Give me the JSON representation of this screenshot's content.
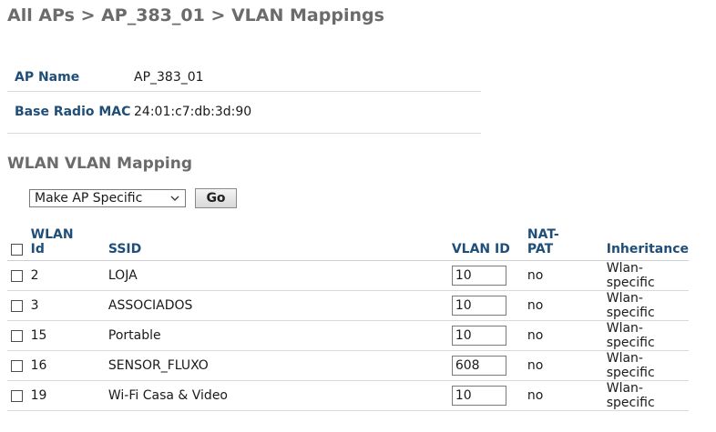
{
  "breadcrumb": "All APs > AP_383_01 > VLAN Mappings",
  "ap_info": {
    "ap_name_label": "AP Name",
    "ap_name_value": "AP_383_01",
    "mac_label": "Base Radio MAC",
    "mac_value": "24:01:c7:db:3d:90"
  },
  "section_title": "WLAN VLAN Mapping",
  "controls": {
    "dropdown_value": "Make AP Specific",
    "go_label": "Go"
  },
  "table": {
    "headers": {
      "wlan_id": "WLAN Id",
      "ssid": "SSID",
      "vlan_id": "VLAN ID",
      "nat_pat": "NAT-PAT",
      "inheritance": "Inheritance"
    },
    "rows": [
      {
        "wlan_id": "2",
        "ssid": "LOJA",
        "vlan_id": "10",
        "nat_pat": "no",
        "inheritance": "Wlan-specific"
      },
      {
        "wlan_id": "3",
        "ssid": "ASSOCIADOS",
        "vlan_id": "10",
        "nat_pat": "no",
        "inheritance": "Wlan-specific"
      },
      {
        "wlan_id": "15",
        "ssid": "Portable",
        "vlan_id": "10",
        "nat_pat": "no",
        "inheritance": "Wlan-specific"
      },
      {
        "wlan_id": "16",
        "ssid": "SENSOR_FLUXO",
        "vlan_id": "608",
        "nat_pat": "no",
        "inheritance": "Wlan-specific"
      },
      {
        "wlan_id": "19",
        "ssid": "Wi-Fi Casa & Video",
        "vlan_id": "10",
        "nat_pat": "no",
        "inheritance": "Wlan-specific"
      }
    ]
  },
  "icons": {
    "chevron": "chevron-down-icon"
  },
  "colors": {
    "label_blue": "#1f4e79",
    "title_gray": "#6b6b6b"
  }
}
